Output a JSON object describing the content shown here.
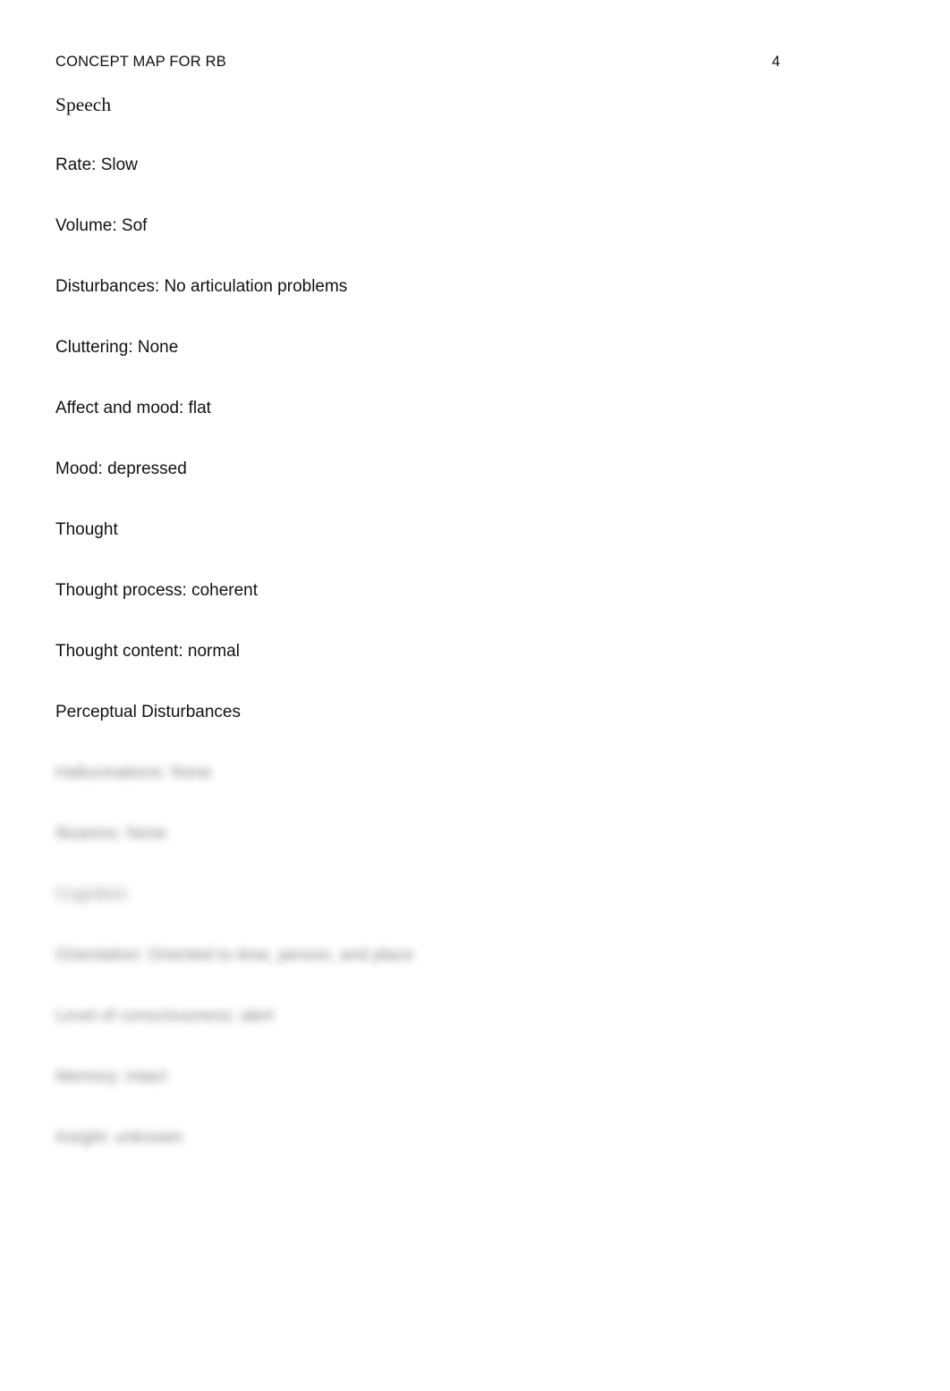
{
  "document": {
    "header": {
      "title": "CONCEPT MAP FOR RB",
      "page_number": "4"
    },
    "sections": [
      {
        "heading": "Speech",
        "lines": [
          "Rate: Slow",
          "Volume: Sof",
          "Disturbances: No articulation problems",
          "Cluttering: None",
          "Affect and mood: flat",
          "Mood: depressed"
        ]
      },
      {
        "heading": "Thought",
        "lines": [
          "Thought process: coherent",
          "Thought content: normal"
        ]
      },
      {
        "heading": "Perceptual Disturbances",
        "lines": []
      }
    ],
    "redacted_lines": [
      "Hallucinations: None",
      "Illusions: None",
      "Cognition",
      "Orientation: Oriented to time, person, and place",
      "Level of consciousness: alert",
      "Memory: intact",
      "Insight: unknown"
    ]
  }
}
